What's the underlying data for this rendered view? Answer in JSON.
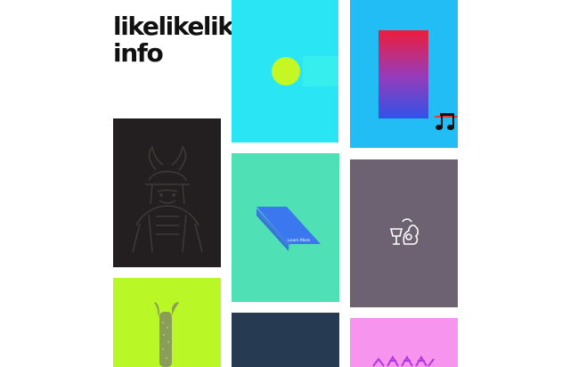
{
  "brand": {
    "line1": "likelikelike",
    "line2": "info"
  },
  "tiles": {
    "cyan": {
      "color": "#2ae6f4",
      "icon": "lime-circle-icon"
    },
    "sky": {
      "color": "#22bdf4",
      "icon": "music-notes-icon"
    },
    "dark": {
      "color": "#231f20",
      "icon": "samurai-illustration"
    },
    "mint": {
      "color": "#4fe0b5",
      "learn_more": "Learn More"
    },
    "mauve": {
      "color": "#6c6272",
      "icon": "cup-bird-icon"
    },
    "lime": {
      "color": "#b9f727",
      "icon": "cactus-illustration"
    },
    "navy": {
      "color": "#263a52"
    },
    "pink": {
      "color": "#f794ee",
      "icon": "purple-pattern-icon"
    }
  }
}
